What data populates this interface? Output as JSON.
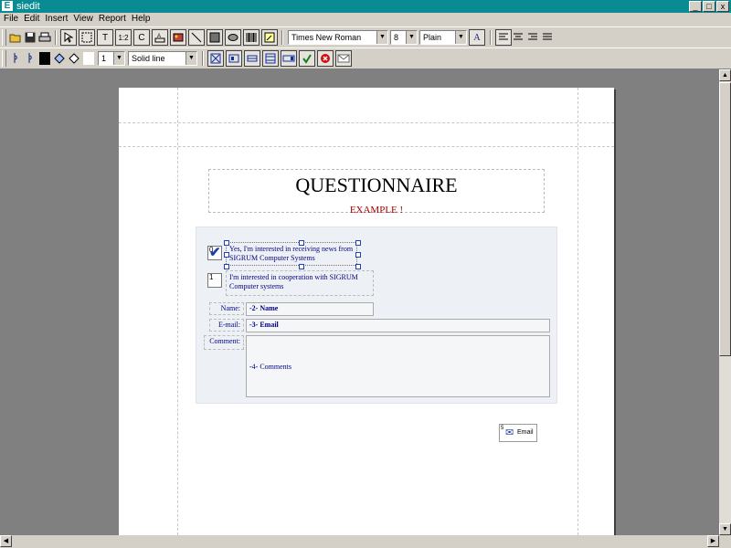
{
  "window": {
    "title": "siedit",
    "app_icon": "E",
    "controls": [
      "_",
      "□",
      "x"
    ]
  },
  "menu": [
    "File",
    "Edit",
    "Insert",
    "View",
    "Report",
    "Help"
  ],
  "toolbar1": {
    "font_name": "Times New Roman",
    "font_size": "8",
    "font_style": "Plain",
    "style_button": "A",
    "text_tool": "T",
    "counter_tool": "1:2",
    "copyright_tool": "C"
  },
  "toolbar2": {
    "line_width": "1",
    "line_style": "Solid line"
  },
  "document": {
    "title": "QUESTIONNAIRE",
    "subtitle": "EXAMPLE !",
    "checkbox1": {
      "index": "0",
      "checked": true,
      "line1": "Yes, I'm interested in receiving news from",
      "line2": "SIGRUM Computer Systems"
    },
    "checkbox2": {
      "index": "1",
      "checked": false,
      "line1": "I'm interested in cooperation with SIGRUM",
      "line2": "Computer systems"
    },
    "fields": {
      "name": {
        "label": "Name:",
        "value": "-2- Name"
      },
      "email": {
        "label": "E-mail:",
        "value": "-3- Email"
      },
      "comment": {
        "label": "Comment:",
        "value": "-4- Comments"
      }
    },
    "email_button": {
      "label": "Email",
      "index": "5"
    }
  },
  "colors": {
    "titlebar": "#088b92",
    "subtitle": "#a00000",
    "form_text": "#000080",
    "form_panel": "#edf1f5"
  }
}
